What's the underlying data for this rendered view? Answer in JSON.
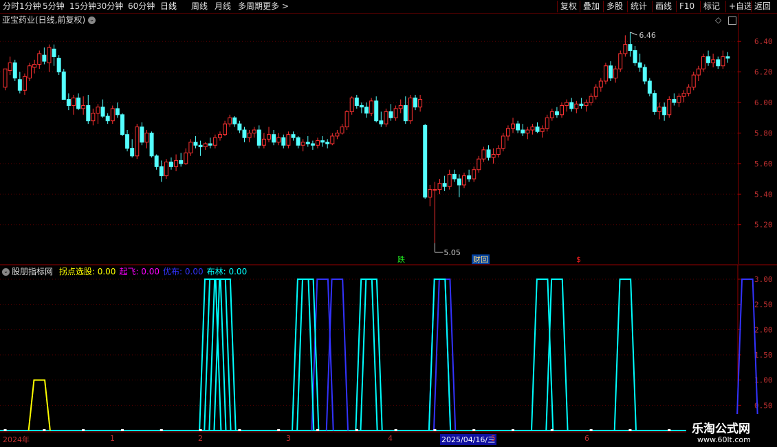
{
  "toolbar": {
    "periods": [
      "分时",
      "1分钟",
      "5分钟",
      "15分钟",
      "30分钟",
      "60分钟",
      "日线",
      "周线",
      "月线",
      "多周期",
      "更多 >"
    ],
    "selected": "日线",
    "right_buttons": [
      "复权",
      "叠加",
      "多股",
      "统计",
      "画线",
      "F10",
      "标记",
      "+自选",
      "返回"
    ]
  },
  "main_pane": {
    "title": "亚宝药业(日线,前复权)",
    "high_label": "6.46",
    "low_label": "5.05",
    "markers": {
      "fall": "跌",
      "finance": "财回",
      "money": "$"
    },
    "y_ticks": [
      "6.40",
      "6.20",
      "6.00",
      "5.80",
      "5.60",
      "5.40",
      "5.20"
    ]
  },
  "indicator_pane": {
    "name": "股朋指标网",
    "items": [
      {
        "label": "拐点选股:",
        "value": "0.00",
        "color": "#ffff00"
      },
      {
        "label": "起飞:",
        "value": "0.00",
        "color": "#ff00ff"
      },
      {
        "label": "优布:",
        "value": "0.00",
        "color": "#3333ff"
      },
      {
        "label": "布林:",
        "value": "0.00",
        "color": "#00ffff"
      }
    ],
    "y_ticks": [
      "3.00",
      "2.50",
      "2.00",
      "1.50",
      "1.00",
      "0.50"
    ]
  },
  "x_axis": {
    "labels": [
      "2024年",
      "1",
      "2",
      "3",
      "4",
      "2025/04/16/三",
      "5",
      "6"
    ]
  },
  "watermark": {
    "text": "乐淘公式网",
    "url": "www.60lt.com"
  },
  "chart_data": {
    "type": "candlestick",
    "title": "亚宝药业(日线,前复权)",
    "ylim": [
      5.05,
      6.5
    ],
    "annotations": {
      "high": 6.46,
      "low": 5.05
    },
    "candles": [
      [
        6.1,
        6.22,
        6.08,
        6.22
      ],
      [
        6.21,
        6.3,
        6.18,
        6.26
      ],
      [
        6.26,
        6.28,
        6.14,
        6.16
      ],
      [
        6.15,
        6.2,
        6.06,
        6.08
      ],
      [
        6.08,
        6.19,
        6.05,
        6.17
      ],
      [
        6.16,
        6.26,
        6.14,
        6.24
      ],
      [
        6.23,
        6.28,
        6.19,
        6.25
      ],
      [
        6.25,
        6.34,
        6.22,
        6.32
      ],
      [
        6.31,
        6.36,
        6.25,
        6.27
      ],
      [
        6.26,
        6.38,
        6.2,
        6.36
      ],
      [
        6.35,
        6.38,
        6.24,
        6.3
      ],
      [
        6.29,
        6.31,
        6.18,
        6.2
      ],
      [
        6.2,
        6.22,
        6.02,
        6.02
      ],
      [
        6.02,
        6.06,
        5.95,
        5.98
      ],
      [
        5.98,
        6.05,
        5.92,
        6.03
      ],
      [
        6.03,
        6.06,
        5.95,
        5.96
      ],
      [
        5.96,
        6.04,
        5.92,
        5.98
      ],
      [
        5.98,
        6.05,
        5.86,
        5.88
      ],
      [
        5.88,
        5.96,
        5.85,
        5.93
      ],
      [
        5.93,
        5.99,
        5.86,
        5.97
      ],
      [
        5.97,
        6.02,
        5.9,
        5.91
      ],
      [
        5.91,
        5.93,
        5.86,
        5.88
      ],
      [
        5.88,
        5.98,
        5.86,
        5.96
      ],
      [
        5.96,
        6.0,
        5.9,
        5.92
      ],
      [
        5.92,
        5.93,
        5.78,
        5.79
      ],
      [
        5.79,
        5.82,
        5.68,
        5.7
      ],
      [
        5.7,
        5.76,
        5.64,
        5.65
      ],
      [
        5.65,
        5.86,
        5.63,
        5.84
      ],
      [
        5.84,
        5.87,
        5.72,
        5.74
      ],
      [
        5.74,
        5.82,
        5.7,
        5.8
      ],
      [
        5.8,
        5.81,
        5.64,
        5.65
      ],
      [
        5.65,
        5.66,
        5.56,
        5.58
      ],
      [
        5.58,
        5.62,
        5.48,
        5.52
      ],
      [
        5.52,
        5.63,
        5.5,
        5.61
      ],
      [
        5.61,
        5.64,
        5.56,
        5.58
      ],
      [
        5.58,
        5.66,
        5.55,
        5.62
      ],
      [
        5.62,
        5.67,
        5.58,
        5.6
      ],
      [
        5.6,
        5.7,
        5.59,
        5.67
      ],
      [
        5.67,
        5.76,
        5.65,
        5.74
      ],
      [
        5.74,
        5.78,
        5.7,
        5.72
      ],
      [
        5.72,
        5.75,
        5.65,
        5.71
      ],
      [
        5.71,
        5.74,
        5.69,
        5.73
      ],
      [
        5.73,
        5.77,
        5.7,
        5.72
      ],
      [
        5.72,
        5.79,
        5.7,
        5.77
      ],
      [
        5.77,
        5.81,
        5.75,
        5.79
      ],
      [
        5.79,
        5.88,
        5.78,
        5.86
      ],
      [
        5.86,
        5.92,
        5.84,
        5.9
      ],
      [
        5.9,
        5.91,
        5.84,
        5.86
      ],
      [
        5.86,
        5.88,
        5.8,
        5.82
      ],
      [
        5.82,
        5.84,
        5.74,
        5.77
      ],
      [
        5.77,
        5.82,
        5.74,
        5.8
      ],
      [
        5.8,
        5.84,
        5.77,
        5.82
      ],
      [
        5.82,
        5.85,
        5.7,
        5.72
      ],
      [
        5.72,
        5.8,
        5.7,
        5.76
      ],
      [
        5.76,
        5.84,
        5.74,
        5.79
      ],
      [
        5.79,
        5.82,
        5.72,
        5.74
      ],
      [
        5.74,
        5.8,
        5.72,
        5.77
      ],
      [
        5.77,
        5.79,
        5.7,
        5.72
      ],
      [
        5.72,
        5.81,
        5.7,
        5.79
      ],
      [
        5.79,
        5.81,
        5.75,
        5.77
      ],
      [
        5.77,
        5.78,
        5.7,
        5.72
      ],
      [
        5.72,
        5.76,
        5.68,
        5.74
      ],
      [
        5.74,
        5.78,
        5.71,
        5.73
      ],
      [
        5.73,
        5.75,
        5.69,
        5.72
      ],
      [
        5.72,
        5.77,
        5.7,
        5.75
      ],
      [
        5.75,
        5.78,
        5.71,
        5.74
      ],
      [
        5.74,
        5.76,
        5.7,
        5.73
      ],
      [
        5.73,
        5.8,
        5.72,
        5.78
      ],
      [
        5.78,
        5.82,
        5.76,
        5.8
      ],
      [
        5.8,
        5.86,
        5.79,
        5.84
      ],
      [
        5.84,
        5.95,
        5.82,
        5.94
      ],
      [
        5.94,
        6.04,
        5.92,
        6.03
      ],
      [
        6.03,
        6.05,
        5.96,
        5.98
      ],
      [
        5.98,
        6.0,
        5.93,
        5.97
      ],
      [
        5.97,
        6.0,
        5.9,
        5.93
      ],
      [
        5.93,
        6.03,
        5.91,
        6.01
      ],
      [
        6.01,
        6.04,
        5.87,
        5.88
      ],
      [
        5.88,
        5.94,
        5.84,
        5.86
      ],
      [
        5.86,
        5.96,
        5.84,
        5.94
      ],
      [
        5.94,
        5.99,
        5.88,
        5.9
      ],
      [
        5.9,
        5.98,
        5.88,
        5.96
      ],
      [
        5.96,
        6.02,
        5.93,
        5.98
      ],
      [
        5.98,
        6.04,
        5.86,
        5.88
      ],
      [
        5.88,
        6.05,
        5.86,
        6.03
      ],
      [
        6.03,
        6.05,
        5.95,
        5.97
      ],
      [
        5.97,
        6.05,
        5.94,
        6.02
      ],
      [
        5.85,
        5.86,
        5.37,
        5.38
      ],
      [
        5.38,
        5.46,
        5.32,
        5.43
      ],
      [
        5.43,
        5.48,
        5.08,
        5.43
      ],
      [
        5.43,
        5.5,
        5.4,
        5.47
      ],
      [
        5.47,
        5.52,
        5.42,
        5.45
      ],
      [
        5.45,
        5.56,
        5.43,
        5.53
      ],
      [
        5.53,
        5.56,
        5.48,
        5.5
      ],
      [
        5.5,
        5.53,
        5.38,
        5.46
      ],
      [
        5.46,
        5.54,
        5.44,
        5.52
      ],
      [
        5.52,
        5.56,
        5.48,
        5.5
      ],
      [
        5.5,
        5.58,
        5.48,
        5.56
      ],
      [
        5.56,
        5.65,
        5.54,
        5.63
      ],
      [
        5.63,
        5.71,
        5.61,
        5.69
      ],
      [
        5.69,
        5.72,
        5.62,
        5.64
      ],
      [
        5.64,
        5.7,
        5.6,
        5.66
      ],
      [
        5.66,
        5.72,
        5.64,
        5.7
      ],
      [
        5.7,
        5.8,
        5.68,
        5.78
      ],
      [
        5.78,
        5.85,
        5.75,
        5.83
      ],
      [
        5.83,
        5.9,
        5.8,
        5.86
      ],
      [
        5.86,
        5.88,
        5.8,
        5.82
      ],
      [
        5.82,
        5.86,
        5.78,
        5.8
      ],
      [
        5.8,
        5.84,
        5.76,
        5.82
      ],
      [
        5.82,
        5.86,
        5.79,
        5.84
      ],
      [
        5.84,
        5.87,
        5.8,
        5.81
      ],
      [
        5.81,
        5.85,
        5.77,
        5.83
      ],
      [
        5.83,
        5.92,
        5.81,
        5.9
      ],
      [
        5.9,
        5.96,
        5.88,
        5.94
      ],
      [
        5.94,
        5.97,
        5.9,
        5.92
      ],
      [
        5.92,
        6.0,
        5.9,
        5.98
      ],
      [
        5.98,
        6.02,
        5.94,
        6.0
      ],
      [
        6.0,
        6.03,
        5.94,
        5.96
      ],
      [
        5.96,
        6.01,
        5.93,
        5.99
      ],
      [
        5.99,
        6.03,
        5.96,
        5.98
      ],
      [
        5.98,
        6.02,
        5.94,
        6.0
      ],
      [
        6.0,
        6.06,
        5.98,
        6.04
      ],
      [
        6.04,
        6.12,
        6.02,
        6.1
      ],
      [
        6.1,
        6.16,
        6.07,
        6.14
      ],
      [
        6.14,
        6.26,
        6.12,
        6.24
      ],
      [
        6.24,
        6.27,
        6.14,
        6.16
      ],
      [
        6.16,
        6.24,
        6.13,
        6.22
      ],
      [
        6.22,
        6.34,
        6.2,
        6.32
      ],
      [
        6.32,
        6.44,
        6.3,
        6.38
      ],
      [
        6.38,
        6.46,
        6.3,
        6.34
      ],
      [
        6.34,
        6.37,
        6.24,
        6.26
      ],
      [
        6.26,
        6.32,
        6.2,
        6.23
      ],
      [
        6.23,
        6.25,
        6.12,
        6.14
      ],
      [
        6.14,
        6.16,
        6.04,
        6.06
      ],
      [
        6.06,
        6.08,
        5.92,
        5.94
      ],
      [
        5.94,
        6.0,
        5.89,
        5.97
      ],
      [
        5.97,
        6.0,
        5.88,
        5.92
      ],
      [
        5.92,
        6.04,
        5.9,
        6.02
      ],
      [
        6.02,
        6.06,
        5.98,
        6.0
      ],
      [
        6.0,
        6.06,
        5.97,
        6.04
      ],
      [
        6.04,
        6.08,
        6.0,
        6.06
      ],
      [
        6.06,
        6.12,
        6.04,
        6.1
      ],
      [
        6.1,
        6.2,
        6.08,
        6.18
      ],
      [
        6.18,
        6.24,
        6.14,
        6.22
      ],
      [
        6.22,
        6.32,
        6.2,
        6.3
      ],
      [
        6.3,
        6.34,
        6.24,
        6.26
      ],
      [
        6.26,
        6.32,
        6.23,
        6.28
      ],
      [
        6.28,
        6.3,
        6.22,
        6.24
      ],
      [
        6.24,
        6.34,
        6.22,
        6.3
      ],
      [
        6.3,
        6.33,
        6.26,
        6.29
      ]
    ],
    "indicator": {
      "ylim": [
        0,
        3.2
      ],
      "series": [
        {
          "name": "拐点选股",
          "color": "#ffff00",
          "values": [
            [
              7,
              1
            ]
          ]
        },
        {
          "name": "优布",
          "color": "#3333ff",
          "values": [
            [
              65,
              3
            ],
            [
              68,
              3
            ],
            [
              89,
              3
            ],
            [
              90,
              3
            ],
            [
              152,
              3
            ]
          ]
        },
        {
          "name": "布林",
          "color": "#00ffff",
          "values": [
            [
              42,
              3
            ],
            [
              43,
              3
            ],
            [
              44,
              3
            ],
            [
              45,
              3
            ],
            [
              61,
              3
            ],
            [
              62,
              3
            ],
            [
              74,
              3
            ],
            [
              75,
              3
            ],
            [
              89,
              3
            ],
            [
              110,
              3
            ],
            [
              113,
              3
            ],
            [
              127,
              3
            ]
          ]
        }
      ]
    }
  }
}
